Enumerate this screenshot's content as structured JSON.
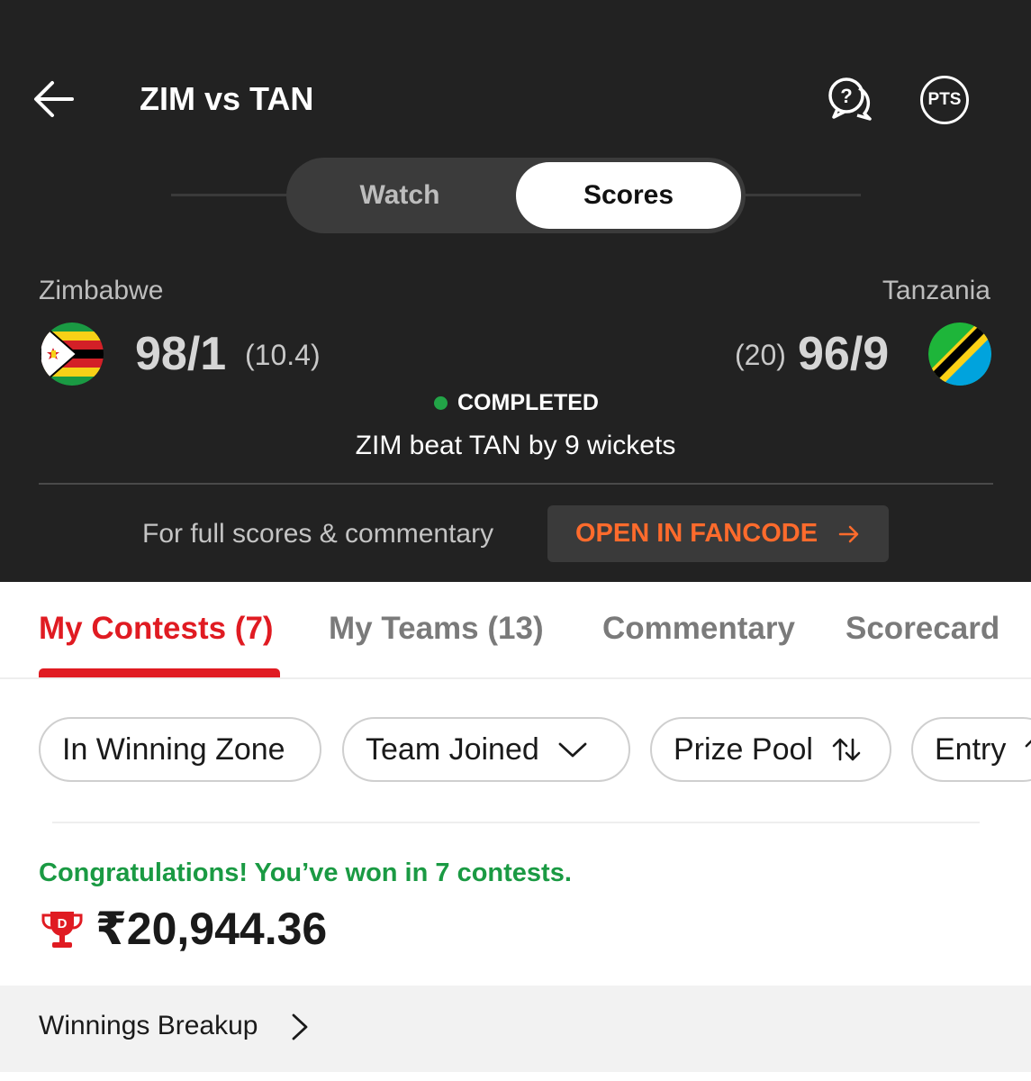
{
  "header": {
    "title": "ZIM vs TAN",
    "pts_label": "PTS"
  },
  "toggle": {
    "watch_label": "Watch",
    "scores_label": "Scores",
    "selected": "Scores"
  },
  "match": {
    "team1": {
      "name": "Zimbabwe",
      "score": "98/1",
      "overs": "(10.4)"
    },
    "team2": {
      "name": "Tanzania",
      "score": "96/9",
      "overs": "(20)"
    },
    "status": "COMPLETED",
    "result": "ZIM beat TAN by 9 wickets"
  },
  "fancode": {
    "prompt": "For full scores & commentary",
    "button_label": "OPEN IN FANCODE"
  },
  "tabs": [
    {
      "label": "My Contests (7)",
      "active": true
    },
    {
      "label": "My Teams (13)",
      "active": false
    },
    {
      "label": "Commentary",
      "active": false
    },
    {
      "label": "Scorecard",
      "active": false
    }
  ],
  "filters": [
    {
      "label": "In Winning Zone",
      "icon": ""
    },
    {
      "label": "Team Joined",
      "icon": "chevron-down-icon"
    },
    {
      "label": "Prize Pool",
      "icon": "sort-icon"
    },
    {
      "label": "Entry",
      "icon": "sort-icon"
    }
  ],
  "winnings": {
    "message": "Congratulations! You’ve won in 7 contests.",
    "amount": "₹20,944.36",
    "breakup_label": "Winnings Breakup"
  },
  "colors": {
    "header_bg": "#222222",
    "accent_red": "#e01b22",
    "fancode_orange": "#ff6b2c",
    "success_green": "#1a9a43"
  }
}
